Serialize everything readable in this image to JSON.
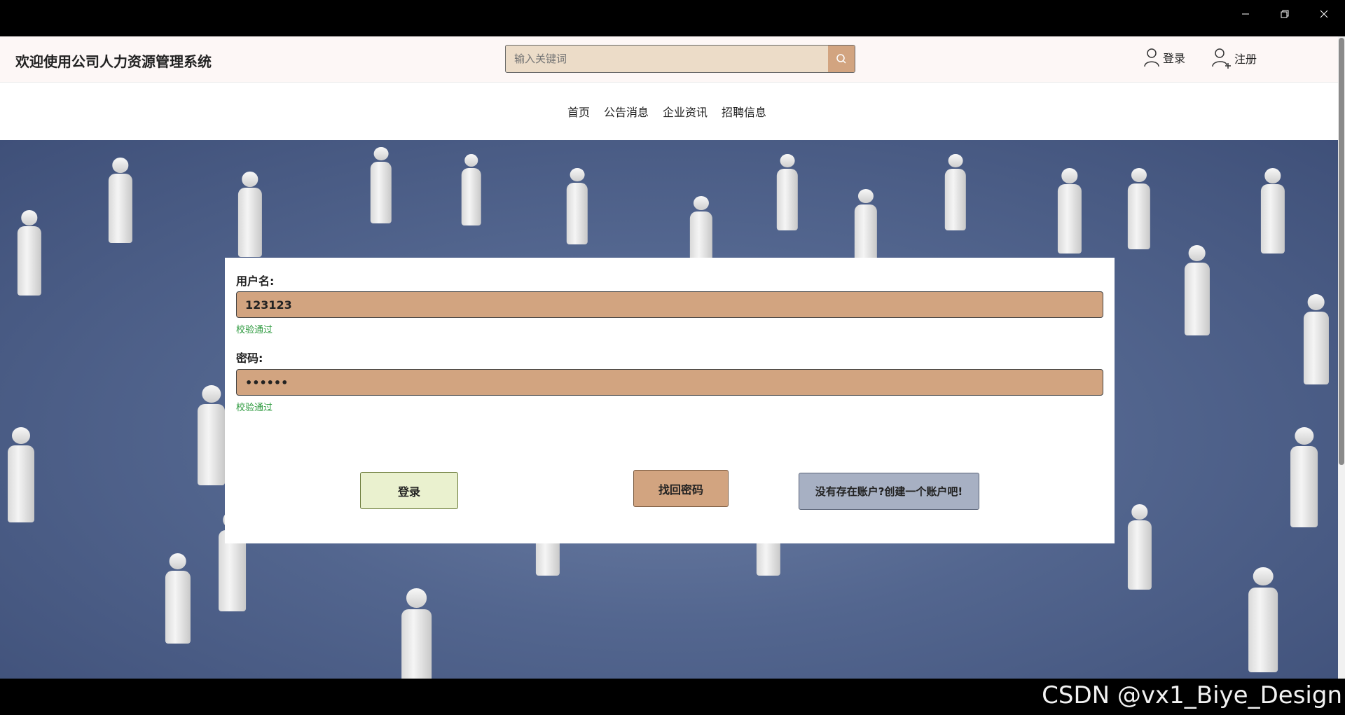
{
  "window": {
    "minimize_icon": "minimize-icon",
    "maximize_icon": "restore-icon",
    "close_icon": "close-icon"
  },
  "header": {
    "title": "欢迎使用公司人力资源管理系统",
    "search_placeholder": "输入关键词",
    "search_icon": "search-icon",
    "login_label": "登录",
    "register_label": "注册"
  },
  "nav": {
    "items": [
      {
        "label": "首页"
      },
      {
        "label": "公告消息"
      },
      {
        "label": "企业资讯"
      },
      {
        "label": "招聘信息"
      }
    ]
  },
  "form": {
    "username_label": "用户名:",
    "username_value": "123123",
    "username_status": "校验通过",
    "password_label": "密码:",
    "password_value": "••••••",
    "password_status": "校验通过",
    "login_button": "登录",
    "recover_button": "找回密码",
    "register_button": "没有存在账户?创建一个账户吧!"
  },
  "watermark": "CSDN @vx1_Biye_Design",
  "colors": {
    "accent": "#d2a480",
    "success": "#2e9a3f",
    "login_btn": "#eaf1cf",
    "register_btn": "#a7b0c3"
  }
}
